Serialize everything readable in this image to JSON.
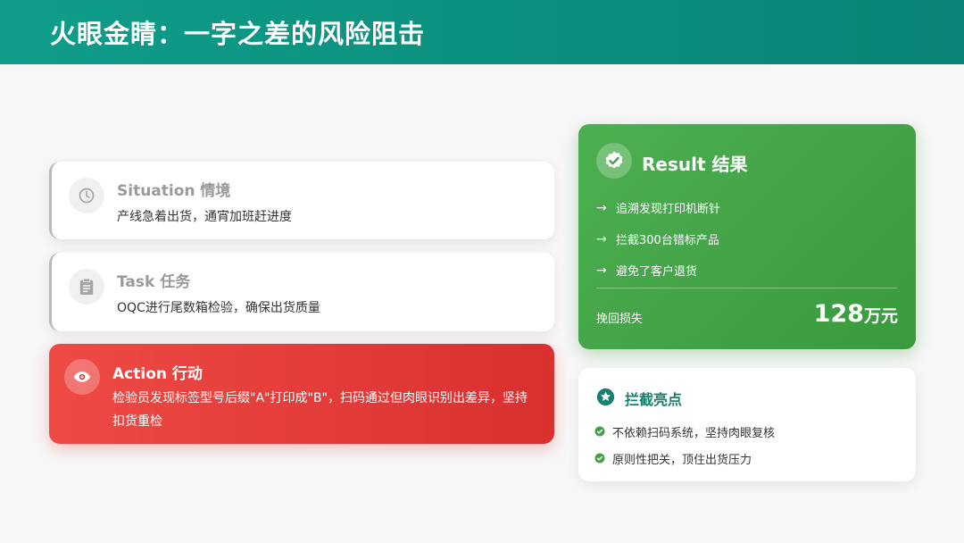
{
  "header": {
    "title": "火眼金睛：一字之差的风险阻击"
  },
  "star": {
    "situation": {
      "title": "Situation 情境",
      "desc": "产线急着出货，通宵加班赶进度",
      "icon": "clock-icon"
    },
    "task": {
      "title": "Task 任务",
      "desc": "OQC进行尾数箱检验，确保出货质量",
      "icon": "clipboard-icon"
    },
    "action": {
      "title": "Action 行动",
      "desc": "检验员发现标签型号后缀\"A\"打印成\"B\"，扫码通过但肉眼识别出差异，坚持扣货重检",
      "icon": "eye-icon"
    }
  },
  "result": {
    "title": "Result 结果",
    "icon": "verified-badge-icon",
    "items": [
      "追溯发现打印机断针",
      "拦截300台错标产品",
      "避免了客户退货"
    ],
    "loss_label": "挽回损失",
    "loss_value": "128",
    "loss_unit": "万元"
  },
  "highlight": {
    "title": "拦截亮点",
    "icon": "star-icon",
    "items": [
      "不依赖扫码系统，坚持肉眼复核",
      "原则性把关，顶住出货压力"
    ]
  },
  "colors": {
    "header": "#0f9d8a",
    "action": "#e53935",
    "result": "#43a047",
    "highlight_title": "#14806f"
  }
}
